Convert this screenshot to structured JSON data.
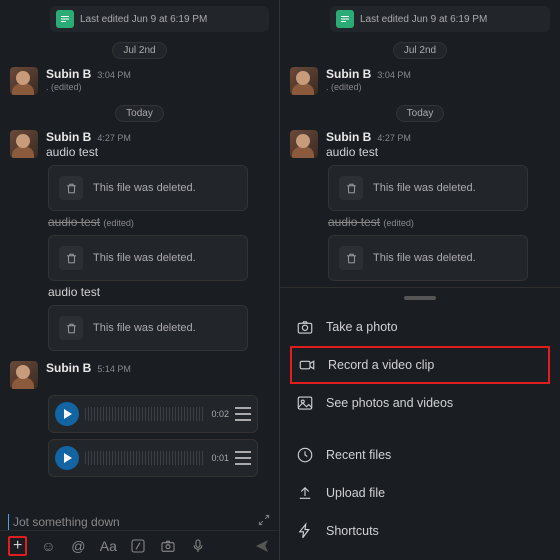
{
  "panes": {
    "left": {
      "lastEdited": "Last edited Jun 9 at 6:19 PM",
      "dates": {
        "jul2": "Jul 2nd",
        "today": "Today"
      },
      "user": "Subin B",
      "times": {
        "m1": "3:04 PM",
        "m2": "4:27 PM",
        "m3": "5:14 PM"
      },
      "texts": {
        "dotEdited": ". (edited)",
        "audioTest": "audio test",
        "audioTestStrike": "audio test",
        "editedSuffix": "(edited)",
        "deleted": "This file was deleted.",
        "audioDur": "0:02",
        "audioTotal": "0:01"
      },
      "composer": {
        "placeholder": "Jot something down"
      }
    },
    "right": {
      "lastEdited": "Last edited Jun 9 at 6:19 PM",
      "sheet": {
        "takePhoto": "Take a photo",
        "recordVideo": "Record a video clip",
        "seePhotos": "See photos and videos",
        "recentFiles": "Recent files",
        "uploadFile": "Upload file",
        "shortcuts": "Shortcuts"
      }
    }
  }
}
